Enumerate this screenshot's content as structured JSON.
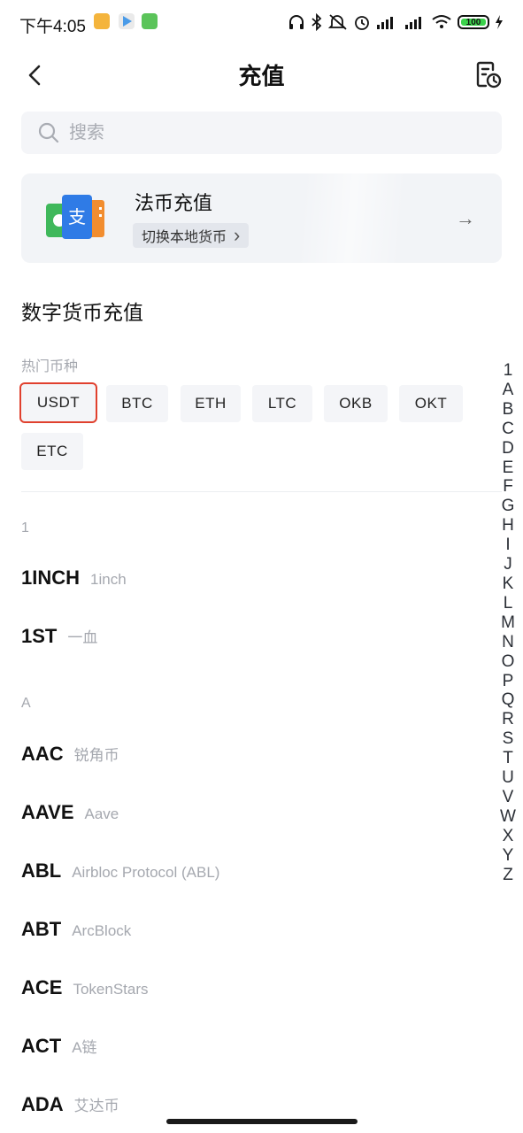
{
  "status_bar": {
    "time": "下午4:05",
    "battery": "100"
  },
  "header": {
    "title": "充值"
  },
  "search": {
    "placeholder": "搜索"
  },
  "fiat_card": {
    "title": "法币充值",
    "switch_label": "切换本地货币",
    "switch_chevron": "›",
    "arrow": "→"
  },
  "digital": {
    "section_title": "数字货币充值",
    "hot_label": "热门币种",
    "hot_coins": [
      "USDT",
      "BTC",
      "ETH",
      "LTC",
      "OKB",
      "OKT",
      "ETC"
    ],
    "selected": "USDT"
  },
  "groups": [
    {
      "label": "1",
      "coins": [
        {
          "symbol": "1INCH",
          "name": "1inch"
        },
        {
          "symbol": "1ST",
          "name": "一血"
        }
      ]
    },
    {
      "label": "A",
      "coins": [
        {
          "symbol": "AAC",
          "name": "锐角币"
        },
        {
          "symbol": "AAVE",
          "name": "Aave"
        },
        {
          "symbol": "ABL",
          "name": "Airbloc Protocol (ABL)"
        },
        {
          "symbol": "ABT",
          "name": "ArcBlock"
        },
        {
          "symbol": "ACE",
          "name": "TokenStars"
        },
        {
          "symbol": "ACT",
          "name": "A链"
        },
        {
          "symbol": "ADA",
          "name": "艾达币"
        }
      ]
    }
  ],
  "index_letters": [
    "1",
    "A",
    "B",
    "C",
    "D",
    "E",
    "F",
    "G",
    "H",
    "I",
    "J",
    "K",
    "L",
    "M",
    "N",
    "O",
    "P",
    "Q",
    "R",
    "S",
    "T",
    "U",
    "V",
    "W",
    "X",
    "Y",
    "Z"
  ],
  "icons": {
    "back": "back-arrow-icon",
    "history": "record-clock-icon",
    "search": "search-icon"
  },
  "colors": {
    "selected_border": "#e0402e",
    "chip_bg": "#f4f5f8",
    "muted_text": "#a5a8af"
  }
}
